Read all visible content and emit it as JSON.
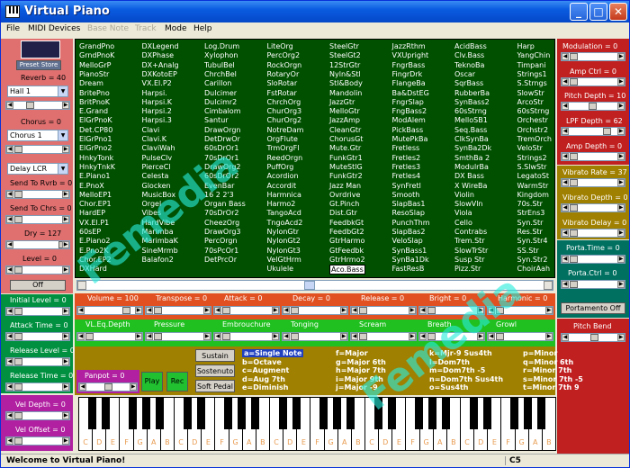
{
  "window": {
    "title": "Virtual Piano"
  },
  "menu": {
    "file": "File",
    "midi": "MIDI Devices",
    "base": "Base Note",
    "track": "Track",
    "mode": "Mode",
    "help": "Help"
  },
  "left": {
    "preset": "Preset Store",
    "reverb": "Reverb = 40",
    "reverb_sel": "Hall 1",
    "chorus": "Chorus = 0",
    "chorus_sel": "Chorus 1",
    "delay_sel": "Delay LCR",
    "send_rvrb": "Send To Rvrb = 0",
    "send_chrs": "Send To Chrs = 0",
    "dry": "Dry = 127",
    "level": "Level = 0",
    "off": "Off",
    "initial_level": "Initial Level = 0",
    "attack_time": "Attack Time = 0",
    "release_level": "Release Level = 0",
    "release_time": "Release Time = 0",
    "vel_depth": "Vel Depth = 0",
    "vel_offset": "Vel Offset = 0"
  },
  "instruments": [
    [
      "GrandPno",
      "GrndPnoK",
      "MelloGrP",
      "PianoStr",
      "Dream",
      "BritePno",
      "BritPnoK",
      "E.Grand",
      "ElGrPnoK",
      "Det.CP80",
      "ElGrPno1",
      "ElGrPno2",
      "HnkyTonk",
      "HnkyTnkK",
      "E.Piano1",
      "E.PnoX",
      "MelloEP1",
      "Chor.EP1",
      "HardEP",
      "VX.El.P1",
      "60sEP",
      "E.Piano2",
      "E.Pno2K",
      "Chor.EP2",
      "DXHard"
    ],
    [
      "DXLegend",
      "DXPhase",
      "DX+Analg",
      "DXKotoEP",
      "VX.El.P2",
      "Harpsi.",
      "Harpsi.K",
      "Harpsi.2",
      "Harpsi.3",
      "Clavi",
      "Clavi.K",
      "ClaviWah",
      "PulseClv",
      "PierceCl",
      "Celesta",
      "Glocken",
      "MusicBox",
      "Orgel",
      "Vibes",
      "HardVibe",
      "Marimba",
      "MarimbaK",
      "SineMrmb",
      "Balafon2",
      ""
    ],
    [
      "Log.Drum",
      "Xylophon",
      "TubulBel",
      "ChrchBel",
      "Carillon",
      "Dulcimer",
      "Dulcimr2",
      "Cimbalom",
      "Santur",
      "DrawOrgn",
      "DetDrwOr",
      "60sDrOr1",
      "70sDrOr1",
      "DrawOrg2",
      "60sDrOr2",
      "EvenBar",
      "16 2 2'3",
      "Organ Bass",
      "70sDrOr2",
      "CheezOrg",
      "DrawOrg3",
      "PercOrgn",
      "70sPcOr1",
      "DetPrcOr",
      ""
    ],
    [
      "LiteOrg",
      "PercOrg2",
      "RockOrgn",
      "RotaryOr",
      "SloRotar",
      "FstRotar",
      "ChrchOrg",
      "ChurOrg3",
      "ChurOrg2",
      "NotreDam",
      "OrgFlute",
      "TrmOrgFl",
      "ReedOrgn",
      "PuffOrg",
      "Acordion",
      "Accordit",
      "Harmnica",
      "Harmo2",
      "TangoAcd",
      "TngoAcd2",
      "NylonGtr",
      "NylonGt2",
      "NylonGt3",
      "VelGtHrm",
      "Ukulele"
    ],
    [
      "SteelGtr",
      "SteelGt2",
      "12StrGtr",
      "Nyln&Stl",
      "Stl&Body",
      "Mandolin",
      "JazzGtr",
      "MelloGtr",
      "JazzAmp",
      "CleanGtr",
      "ChorusGt",
      "Mute.Gtr",
      "FunkGtr1",
      "MuteStlG",
      "FunkGtr2",
      "Jazz Man",
      "Ovrdrive",
      "Gt.Pinch",
      "Dist.Gtr",
      "FeedbkGt",
      "FeedbGt2",
      "GtrHarmo",
      "GtFeedbk",
      "GtrHrmo2",
      "Aco.Bass"
    ],
    [
      "JazzRthm",
      "VXUpright",
      "FngrBass",
      "FingrDrk",
      "FlangeBa",
      "Ba&DstEG",
      "FngrSlap",
      "FngBass2",
      "ModAlem",
      "PickBass",
      "MutePkBa",
      "Fretless",
      "Fretles2",
      "Fretles3",
      "Fretles4",
      "SynFretl",
      "Smooth",
      "SlapBas1",
      "ResoSlap",
      "PunchThm",
      "SlapBas2",
      "VeloSlap",
      "SynBass1",
      "SynBa1Dk",
      "FastResB"
    ],
    [
      "AcidBass",
      "Clv.Bass",
      "TeknoBa",
      "Oscar",
      "SqrBass",
      "RubberBa",
      "SynBass2",
      "60sStrng",
      "MelloSB1",
      "Seq.Bass",
      "ClkSynBa",
      "SynBa2Dk",
      "SmthBa 2",
      "ModulrBa",
      "DX Bass",
      "X WireBa",
      "Violin",
      "SlowVln",
      "Viola",
      "Cello",
      "Contrabs",
      "Trem.Str",
      "SlowTrStr",
      "Susp Str",
      "Pizz.Str"
    ],
    [
      "Harp",
      "YangChin",
      "Timpani",
      "Strings1",
      "S.Strngs",
      "SlowStr",
      "ArcoStr",
      "60sStrng",
      "Orchestr",
      "Orchstr2",
      "TremOrch",
      "VeloStr",
      "Strings2",
      "S.SlwStr",
      "LegatoSt",
      "WarmStr",
      "Kingdom",
      "70s.Str",
      "StrEns3",
      "Syn.Str",
      "Res.Str",
      "Syn.Str4",
      "SS.Str",
      "Syn.Str2",
      "ChoirAah"
    ]
  ],
  "selected_instrument": "Aco.Bass",
  "right": {
    "modulation": "Modulation = 0",
    "amp_ctrl": "Amp Ctrl = 0",
    "pitch_depth": "Pitch Depth = 10",
    "lpf_depth": "LPF Depth = 62",
    "amp_depth": "Amp Depth = 0",
    "vibrato_rate": "Vibrato Rate = 37",
    "vibrato_depth": "Vibrato Depth = 0",
    "vibrato_delay": "Vibrato Delay = 0",
    "porta_time": "Porta.Time = 0",
    "porta_ctrl": "Porta.Ctrl = 0",
    "portamento": "Portamento Off",
    "pitch_bend": "Pitch Bend"
  },
  "mid": {
    "volume": "Volume = 100",
    "transpose": "Transpose = 0",
    "attack": "Attack = 0",
    "decay": "Decay = 0",
    "release": "Release = 0",
    "bright": "Bright = 0",
    "harmonic": "Harmonic = 0",
    "vl_eq": "VL.Eq.Depth",
    "pressure": "Pressure",
    "embrouchure": "Embrouchure",
    "tonging": "Tonging",
    "scream": "Scream",
    "breath": "Breath",
    "growl": "Growl"
  },
  "bottom": {
    "sustain": "Sustain",
    "sostenuto": "Sostenuto",
    "soft_pedal": "Soft Pedal",
    "panpot": "Panpot = 0",
    "play": "Play",
    "rec": "Rec"
  },
  "chords": [
    [
      "a=Single Note",
      "b=Octave",
      "c=Augment",
      "d=Aug 7th",
      "e=Diminish"
    ],
    [
      "f=Major",
      "g=Major 6th",
      "h=Major 7th",
      "i=Major 9th",
      "j=Major -9"
    ],
    [
      "k=Mjr-9 Sus4th",
      "l=Dom7th",
      "m=Dom7th -5",
      "n=Dom7th Sus4th",
      "o=Sus4th"
    ],
    [
      "p=Minor",
      "q=Minor 6th",
      "r=Minor 7th",
      "s=Minor 7th -5",
      "t=Minor 7th 9"
    ]
  ],
  "keys": [
    "C",
    "D",
    "E",
    "F",
    "G",
    "A",
    "B"
  ],
  "status": {
    "msg": "Welcome to Virtual Piano!",
    "note": "C5"
  },
  "watermark": "Femedia"
}
